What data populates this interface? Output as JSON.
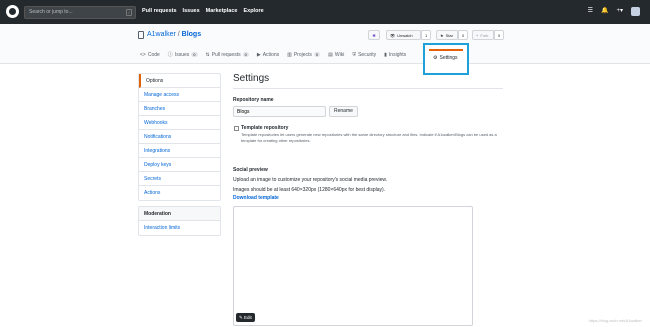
{
  "topbar": {
    "search_placeholder": "Search or jump to...",
    "search_key": "/",
    "nav": [
      "Pull requests",
      "Issues",
      "Marketplace",
      "Explore"
    ],
    "icons": [
      "feed-icon",
      "bell-icon",
      "plus-icon",
      "avatar"
    ]
  },
  "repo": {
    "owner": "A1walker",
    "separator": "/",
    "name": "Blogs",
    "unwatch_label": "Unwatch",
    "unwatch_count": "1",
    "star_label": "Star",
    "star_count": "0",
    "fork_label": "Fork",
    "fork_count": "0"
  },
  "tabs": [
    {
      "label": "Code",
      "count": ""
    },
    {
      "label": "Issues",
      "count": "0"
    },
    {
      "label": "Pull requests",
      "count": "0"
    },
    {
      "label": "Actions",
      "count": ""
    },
    {
      "label": "Projects",
      "count": "0"
    },
    {
      "label": "Wiki",
      "count": ""
    },
    {
      "label": "Security",
      "count": ""
    },
    {
      "label": "Insights",
      "count": ""
    },
    {
      "label": "Settings",
      "count": ""
    }
  ],
  "sidebar": {
    "items": [
      "Options",
      "Manage access",
      "Branches",
      "Webhooks",
      "Notifications",
      "Integrations",
      "Deploy keys",
      "Secrets",
      "Actions"
    ],
    "moderation_heading": "Moderation",
    "moderation_items": [
      "Interaction limits"
    ]
  },
  "main": {
    "title": "Settings",
    "repo_name_label": "Repository name",
    "repo_name_value": "Blogs",
    "rename_button": "Rename",
    "template_label": "Template repository",
    "template_desc": "Template repositories let users generate new repositories with the same directory structure and files. Indicate if A1walker/Blogs can be used as a template for creating other repositories.",
    "social_heading": "Social preview",
    "social_desc": "Upload an image to customize your repository's social media preview.",
    "social_size": "Images should be at least 640×320px (1280×640px for best display).",
    "download_link": "Download template",
    "edit_button": "Edit"
  },
  "watermark": "https://blog.csdn.net/A1walker"
}
